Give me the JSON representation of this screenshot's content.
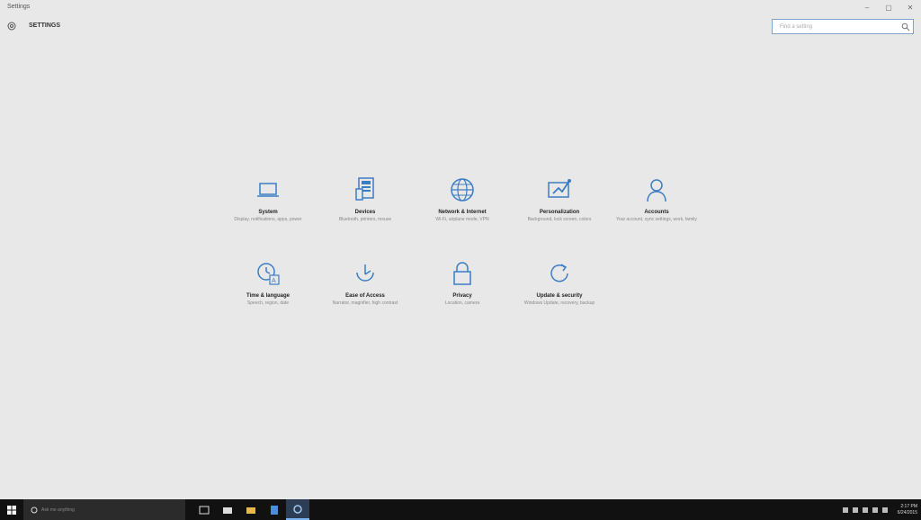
{
  "window": {
    "app_title": "Settings",
    "controls": [
      "–",
      "▢",
      "✕"
    ]
  },
  "header": {
    "title": "SETTINGS"
  },
  "search": {
    "placeholder": "Find a setting"
  },
  "categories": [
    {
      "name": "System",
      "desc": "Display, notifications, apps, power",
      "icon": "laptop-icon"
    },
    {
      "name": "Devices",
      "desc": "Bluetooth, printers, mouse",
      "icon": "devices-icon"
    },
    {
      "name": "Network & Internet",
      "desc": "Wi-Fi, airplane mode, VPN",
      "icon": "globe-icon"
    },
    {
      "name": "Personalization",
      "desc": "Background, lock screen, colors",
      "icon": "personalization-icon"
    },
    {
      "name": "Accounts",
      "desc": "Your account, sync settings, work, family",
      "icon": "person-icon"
    },
    {
      "name": "Time & language",
      "desc": "Speech, region, date",
      "icon": "time-language-icon"
    },
    {
      "name": "Ease of Access",
      "desc": "Narrator, magnifier, high contrast",
      "icon": "ease-of-access-icon"
    },
    {
      "name": "Privacy",
      "desc": "Location, camera",
      "icon": "lock-icon"
    },
    {
      "name": "Update & security",
      "desc": "Windows Update, recovery, backup",
      "icon": "update-icon"
    }
  ],
  "taskbar": {
    "search_text": "Ask me anything",
    "apps": [
      "task-view-icon",
      "store-icon",
      "file-explorer-icon",
      "edge-icon",
      "settings-icon"
    ],
    "clock_time": "2:17 PM",
    "clock_date": "6/24/2015"
  },
  "colors": {
    "accent": "#3b7dc4",
    "background": "#e8e8e8",
    "taskbar": "#111111"
  }
}
